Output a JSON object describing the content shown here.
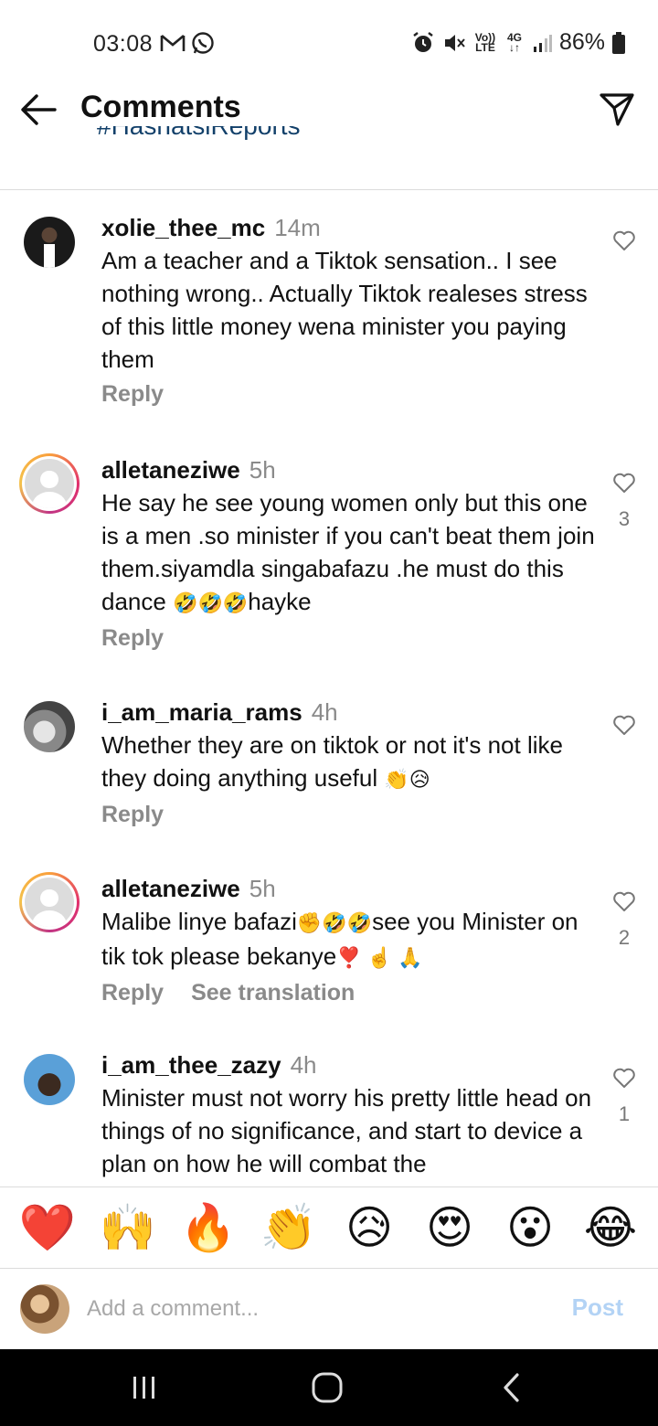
{
  "status": {
    "time": "03:08",
    "battery": "86%",
    "network": "4G",
    "volte": "Vo)) LTE"
  },
  "header": {
    "title": "Comments"
  },
  "caption_clipped": "#HashatsiReports",
  "comments": [
    {
      "user": "xolie_thee_mc",
      "time": "14m",
      "text": "Am a teacher and a Tiktok sensation.. I see nothing wrong.. Actually Tiktok realeses stress of this little money wena minister you paying them",
      "reply": "Reply",
      "likes": ""
    },
    {
      "user": "alletaneziwe",
      "time": "5h",
      "text_parts": [
        "He say he see young  women only but this one is a men .so minister if you can't beat them join them.siyamdla singabafazu .he must do this dance ",
        "🤣🤣🤣",
        "hayke"
      ],
      "reply": "Reply",
      "likes": "3"
    },
    {
      "user": "i_am_maria_rams",
      "time": "4h",
      "text_parts": [
        "Whether they are on tiktok or not it's not like they doing anything useful ",
        "👏😥"
      ],
      "reply": "Reply",
      "likes": ""
    },
    {
      "user": "alletaneziwe",
      "time": "5h",
      "text_parts": [
        "Malibe linye bafazi",
        "✊🤣🤣",
        "see you Minister on tik tok please bekanye",
        "❣️ ☝️ 🙏"
      ],
      "reply": "Reply",
      "see_translation": "See translation",
      "likes": "2"
    },
    {
      "user": "i_am_thee_zazy",
      "time": "4h",
      "text": "Minister must not worry his pretty little head on things of no significance, and start to device a plan on how he will combat the",
      "likes": "1"
    }
  ],
  "reactions": [
    "❤️",
    "🙌",
    "🔥",
    "👏",
    "😥",
    "😍",
    "😮",
    "😂"
  ],
  "composer": {
    "placeholder": "Add a comment...",
    "post_label": "Post"
  }
}
